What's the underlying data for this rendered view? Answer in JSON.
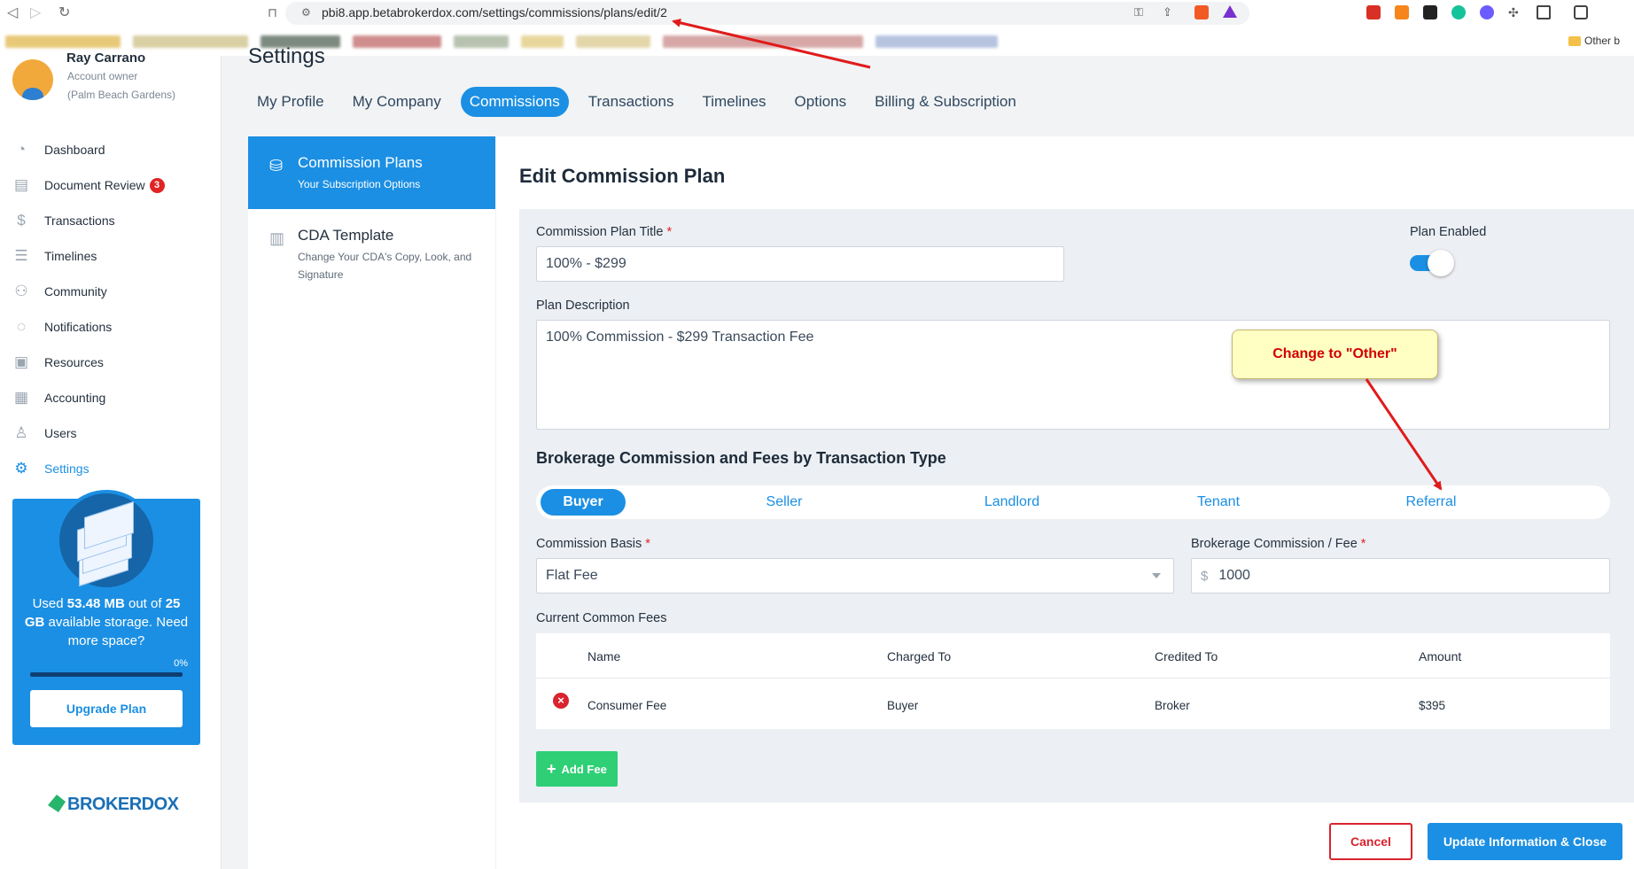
{
  "browser": {
    "url": "pbi8.app.betabrokerdox.com/settings/commissions/plans/edit/2",
    "bookmarks_folder": "Other b"
  },
  "sidebar": {
    "user": {
      "name": "Ray Carrano",
      "role": "Account owner",
      "office": "(Palm Beach Gardens)"
    },
    "items": [
      {
        "label": "Dashboard",
        "icon": "dashboard-icon"
      },
      {
        "label": "Document Review",
        "icon": "document-review-icon",
        "badge": "3"
      },
      {
        "label": "Transactions",
        "icon": "dollar-icon"
      },
      {
        "label": "Timelines",
        "icon": "timeline-icon"
      },
      {
        "label": "Community",
        "icon": "community-icon"
      },
      {
        "label": "Notifications",
        "icon": "chat-bubble-icon"
      },
      {
        "label": "Resources",
        "icon": "resources-icon"
      },
      {
        "label": "Accounting",
        "icon": "calculator-icon"
      },
      {
        "label": "Users",
        "icon": "user-icon"
      },
      {
        "label": "Settings",
        "icon": "gear-icon",
        "active": true
      }
    ],
    "storage": {
      "line1": "Used ",
      "used": "53.48 MB",
      "line2": " out of ",
      "total": "25 GB",
      "line3": " available storage. Need more space?",
      "percent_label": "0%",
      "percent": 0,
      "upgrade_label": "Upgrade Plan"
    },
    "brand": "BROKERDOX"
  },
  "page": {
    "title": "Settings",
    "tabs": [
      {
        "label": "My Profile"
      },
      {
        "label": "My Company"
      },
      {
        "label": "Commissions",
        "active": true
      },
      {
        "label": "Transactions"
      },
      {
        "label": "Timelines"
      },
      {
        "label": "Options"
      },
      {
        "label": "Billing & Subscription"
      }
    ]
  },
  "subnav": [
    {
      "title": "Commission Plans",
      "desc": "Your Subscription Options",
      "active": true
    },
    {
      "title": "CDA Template",
      "desc": "Change Your CDA's Copy, Look, and Signature"
    }
  ],
  "form": {
    "heading": "Edit Commission Plan",
    "plan_title_label": "Commission Plan Title",
    "plan_title_value": "100% - $299",
    "plan_enabled_label": "Plan Enabled",
    "plan_enabled": true,
    "description_label": "Plan Description",
    "description_value": "100% Commission - $299 Transaction Fee",
    "section_title": "Brokerage Commission and Fees by Transaction Type",
    "transaction_types": [
      {
        "label": "Buyer",
        "active": true
      },
      {
        "label": "Seller"
      },
      {
        "label": "Landlord"
      },
      {
        "label": "Tenant"
      },
      {
        "label": "Referral"
      }
    ],
    "commission_basis_label": "Commission Basis",
    "commission_basis_value": "Flat Fee",
    "brokerage_fee_label": "Brokerage Commission / Fee",
    "brokerage_fee_currency": "$",
    "brokerage_fee_value": "1000",
    "fees_label": "Current Common Fees",
    "fees_columns": [
      "Name",
      "Charged To",
      "Credited To",
      "Amount"
    ],
    "fees_rows": [
      {
        "name": "Consumer Fee",
        "charged_to": "Buyer",
        "credited_to": "Broker",
        "amount": "$395"
      }
    ],
    "add_fee_label": "Add Fee",
    "cancel_label": "Cancel",
    "update_label": "Update Information & Close"
  },
  "annotation": {
    "callout_text": "Change to \"Other\"",
    "arrow_color": "#e01b1b"
  }
}
